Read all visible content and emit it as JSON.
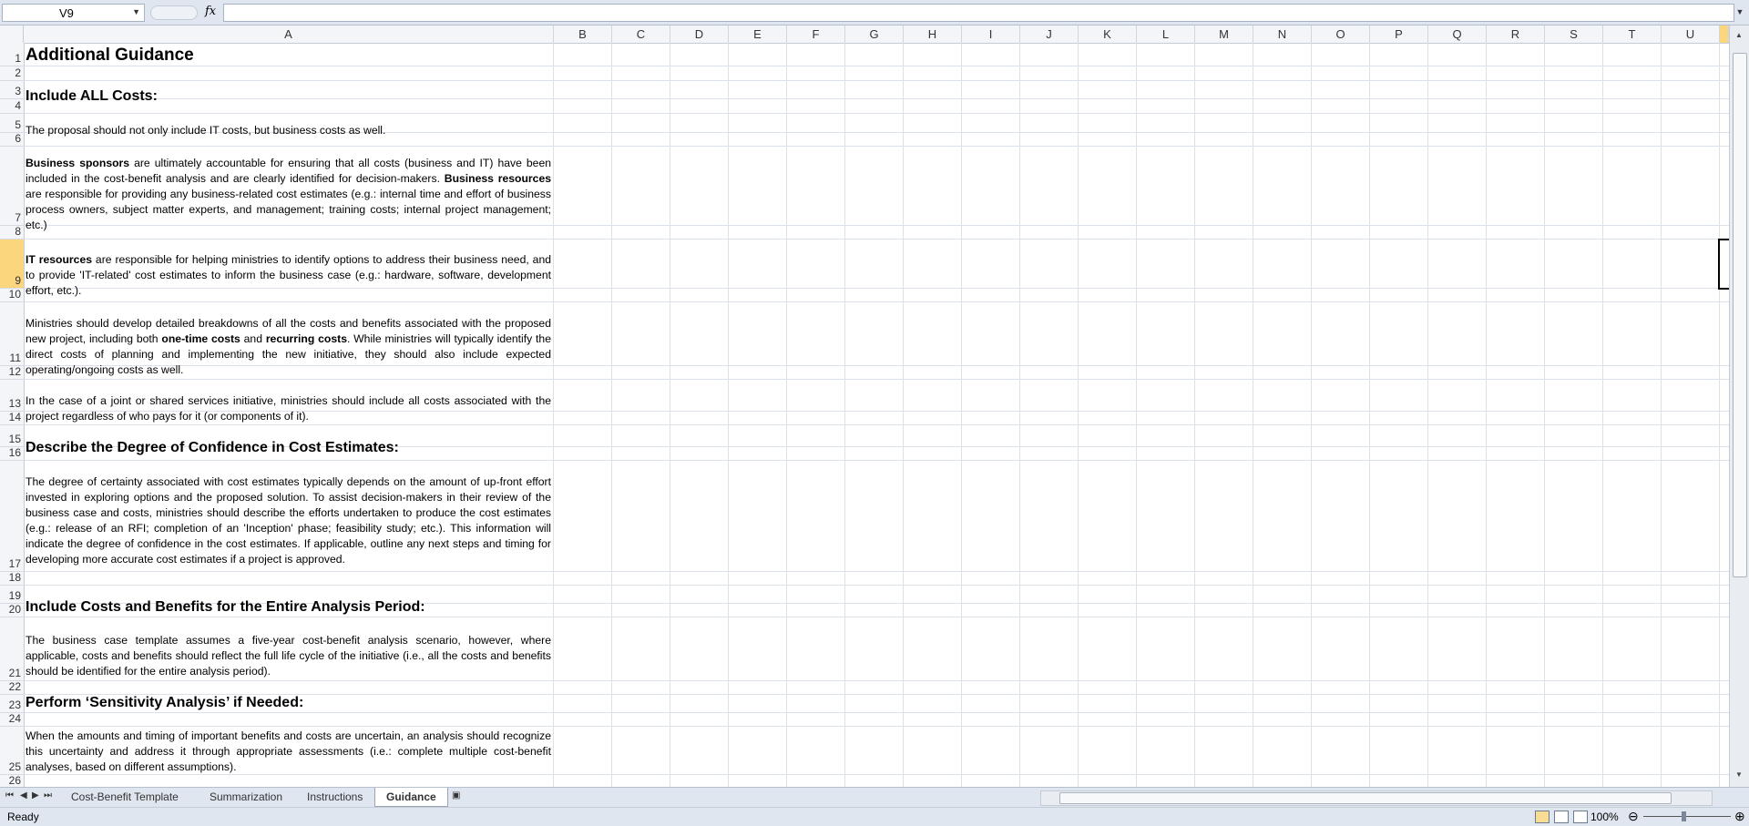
{
  "formula_bar": {
    "name_box": "V9",
    "fx_label": "fx",
    "formula": ""
  },
  "columns": [
    "A",
    "B",
    "C",
    "D",
    "E",
    "F",
    "G",
    "H",
    "I",
    "J",
    "K",
    "L",
    "M",
    "N",
    "O",
    "P",
    "Q",
    "R",
    "S",
    "T",
    "U"
  ],
  "rows": [
    "1",
    "2",
    "3",
    "4",
    "5",
    "6",
    "7",
    "8",
    "9",
    "10",
    "11",
    "12",
    "13",
    "14",
    "15",
    "16",
    "17",
    "18",
    "19",
    "20",
    "21",
    "22",
    "23",
    "24",
    "25",
    "26"
  ],
  "selected_cell": "V9",
  "content": {
    "r1": "Additional Guidance",
    "r3": "Include ALL Costs:",
    "r5": "The proposal should not only include IT costs, but business costs as well.",
    "r7": {
      "b1": "Business sponsors",
      "t1": " are ultimately accountable for ensuring that all costs (business and IT) have been included in the cost-benefit analysis and are clearly identified for decision-makers.  ",
      "b2": "Business resources",
      "t2": " are responsible for providing any business-related cost estimates (e.g.: internal time and effort of business process owners, subject matter experts, and management; training costs; internal project management; etc.)"
    },
    "r9": {
      "b1": "IT resources",
      "t1": " are responsible for helping ministries to identify options to address their business need, and to provide 'IT-related' cost estimates to inform the business case (e.g.: hardware, software, development effort, etc.)."
    },
    "r11": {
      "t1": "Ministries should develop detailed breakdowns of all the costs and benefits associated with the proposed new project, including both ",
      "b1": "one-time costs",
      "t2": " and ",
      "b2": "recurring costs",
      "t3": ". While ministries will typically identify the direct costs of planning and implementing the new initiative, they should also include expected operating/ongoing costs as well."
    },
    "r13": "In the case of a joint or shared services initiative, ministries should include all costs associated with the project regardless of who pays for it (or components of it).",
    "r15": "Describe the Degree of Confidence in Cost Estimates:",
    "r17": "The degree of certainty associated with cost estimates typically depends on the amount of up-front effort invested in exploring options and the proposed solution.  To assist decision-makers in their review of the business case and costs, ministries should describe the efforts undertaken to produce the cost estimates (e.g.: release of an RFI; completion of an 'Inception' phase; feasibility study; etc.). This information will indicate the degree of confidence in the cost estimates.  If applicable, outline any next steps and timing for developing more accurate cost estimates if a project is approved.",
    "r19": "Include Costs and Benefits for the Entire Analysis Period:",
    "r21": "The business case template assumes a five-year cost-benefit analysis scenario, however, where applicable, costs and benefits should reflect the full life cycle of the initiative (i.e., all the costs and benefits should be identified for the entire analysis period).",
    "r23": "Perform ‘Sensitivity Analysis’ if Needed:",
    "r25": "When the amounts and timing of important benefits and costs are uncertain, an analysis should recognize this uncertainty and address it through appropriate assessments (i.e.: complete multiple cost-benefit analyses, based on different assumptions)."
  },
  "sheet_tabs": [
    "Cost-Benefit Template",
    "Summarization",
    "Instructions",
    "Guidance"
  ],
  "active_tab": "Guidance",
  "status": {
    "ready": "Ready",
    "zoom": "100%"
  }
}
